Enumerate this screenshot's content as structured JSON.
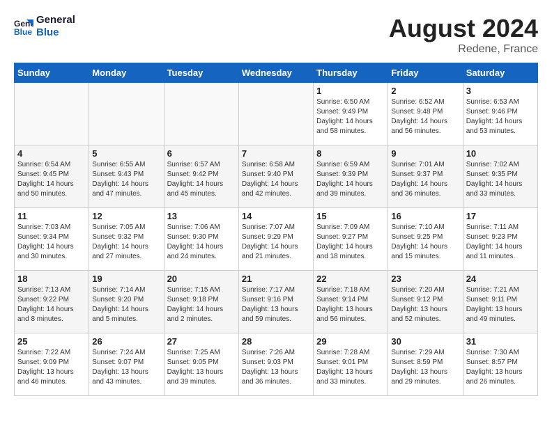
{
  "header": {
    "logo_line1": "General",
    "logo_line2": "Blue",
    "main_title": "August 2024",
    "subtitle": "Redene, France"
  },
  "calendar": {
    "days_of_week": [
      "Sunday",
      "Monday",
      "Tuesday",
      "Wednesday",
      "Thursday",
      "Friday",
      "Saturday"
    ],
    "weeks": [
      [
        {
          "day": "",
          "sunrise": "",
          "sunset": "",
          "daylight": ""
        },
        {
          "day": "",
          "sunrise": "",
          "sunset": "",
          "daylight": ""
        },
        {
          "day": "",
          "sunrise": "",
          "sunset": "",
          "daylight": ""
        },
        {
          "day": "",
          "sunrise": "",
          "sunset": "",
          "daylight": ""
        },
        {
          "day": "1",
          "sunrise": "6:50 AM",
          "sunset": "9:49 PM",
          "daylight": "14 hours and 58 minutes."
        },
        {
          "day": "2",
          "sunrise": "6:52 AM",
          "sunset": "9:48 PM",
          "daylight": "14 hours and 56 minutes."
        },
        {
          "day": "3",
          "sunrise": "6:53 AM",
          "sunset": "9:46 PM",
          "daylight": "14 hours and 53 minutes."
        }
      ],
      [
        {
          "day": "4",
          "sunrise": "6:54 AM",
          "sunset": "9:45 PM",
          "daylight": "14 hours and 50 minutes."
        },
        {
          "day": "5",
          "sunrise": "6:55 AM",
          "sunset": "9:43 PM",
          "daylight": "14 hours and 47 minutes."
        },
        {
          "day": "6",
          "sunrise": "6:57 AM",
          "sunset": "9:42 PM",
          "daylight": "14 hours and 45 minutes."
        },
        {
          "day": "7",
          "sunrise": "6:58 AM",
          "sunset": "9:40 PM",
          "daylight": "14 hours and 42 minutes."
        },
        {
          "day": "8",
          "sunrise": "6:59 AM",
          "sunset": "9:39 PM",
          "daylight": "14 hours and 39 minutes."
        },
        {
          "day": "9",
          "sunrise": "7:01 AM",
          "sunset": "9:37 PM",
          "daylight": "14 hours and 36 minutes."
        },
        {
          "day": "10",
          "sunrise": "7:02 AM",
          "sunset": "9:35 PM",
          "daylight": "14 hours and 33 minutes."
        }
      ],
      [
        {
          "day": "11",
          "sunrise": "7:03 AM",
          "sunset": "9:34 PM",
          "daylight": "14 hours and 30 minutes."
        },
        {
          "day": "12",
          "sunrise": "7:05 AM",
          "sunset": "9:32 PM",
          "daylight": "14 hours and 27 minutes."
        },
        {
          "day": "13",
          "sunrise": "7:06 AM",
          "sunset": "9:30 PM",
          "daylight": "14 hours and 24 minutes."
        },
        {
          "day": "14",
          "sunrise": "7:07 AM",
          "sunset": "9:29 PM",
          "daylight": "14 hours and 21 minutes."
        },
        {
          "day": "15",
          "sunrise": "7:09 AM",
          "sunset": "9:27 PM",
          "daylight": "14 hours and 18 minutes."
        },
        {
          "day": "16",
          "sunrise": "7:10 AM",
          "sunset": "9:25 PM",
          "daylight": "14 hours and 15 minutes."
        },
        {
          "day": "17",
          "sunrise": "7:11 AM",
          "sunset": "9:23 PM",
          "daylight": "14 hours and 11 minutes."
        }
      ],
      [
        {
          "day": "18",
          "sunrise": "7:13 AM",
          "sunset": "9:22 PM",
          "daylight": "14 hours and 8 minutes."
        },
        {
          "day": "19",
          "sunrise": "7:14 AM",
          "sunset": "9:20 PM",
          "daylight": "14 hours and 5 minutes."
        },
        {
          "day": "20",
          "sunrise": "7:15 AM",
          "sunset": "9:18 PM",
          "daylight": "14 hours and 2 minutes."
        },
        {
          "day": "21",
          "sunrise": "7:17 AM",
          "sunset": "9:16 PM",
          "daylight": "13 hours and 59 minutes."
        },
        {
          "day": "22",
          "sunrise": "7:18 AM",
          "sunset": "9:14 PM",
          "daylight": "13 hours and 56 minutes."
        },
        {
          "day": "23",
          "sunrise": "7:20 AM",
          "sunset": "9:12 PM",
          "daylight": "13 hours and 52 minutes."
        },
        {
          "day": "24",
          "sunrise": "7:21 AM",
          "sunset": "9:11 PM",
          "daylight": "13 hours and 49 minutes."
        }
      ],
      [
        {
          "day": "25",
          "sunrise": "7:22 AM",
          "sunset": "9:09 PM",
          "daylight": "13 hours and 46 minutes."
        },
        {
          "day": "26",
          "sunrise": "7:24 AM",
          "sunset": "9:07 PM",
          "daylight": "13 hours and 43 minutes."
        },
        {
          "day": "27",
          "sunrise": "7:25 AM",
          "sunset": "9:05 PM",
          "daylight": "13 hours and 39 minutes."
        },
        {
          "day": "28",
          "sunrise": "7:26 AM",
          "sunset": "9:03 PM",
          "daylight": "13 hours and 36 minutes."
        },
        {
          "day": "29",
          "sunrise": "7:28 AM",
          "sunset": "9:01 PM",
          "daylight": "13 hours and 33 minutes."
        },
        {
          "day": "30",
          "sunrise": "7:29 AM",
          "sunset": "8:59 PM",
          "daylight": "13 hours and 29 minutes."
        },
        {
          "day": "31",
          "sunrise": "7:30 AM",
          "sunset": "8:57 PM",
          "daylight": "13 hours and 26 minutes."
        }
      ]
    ]
  }
}
